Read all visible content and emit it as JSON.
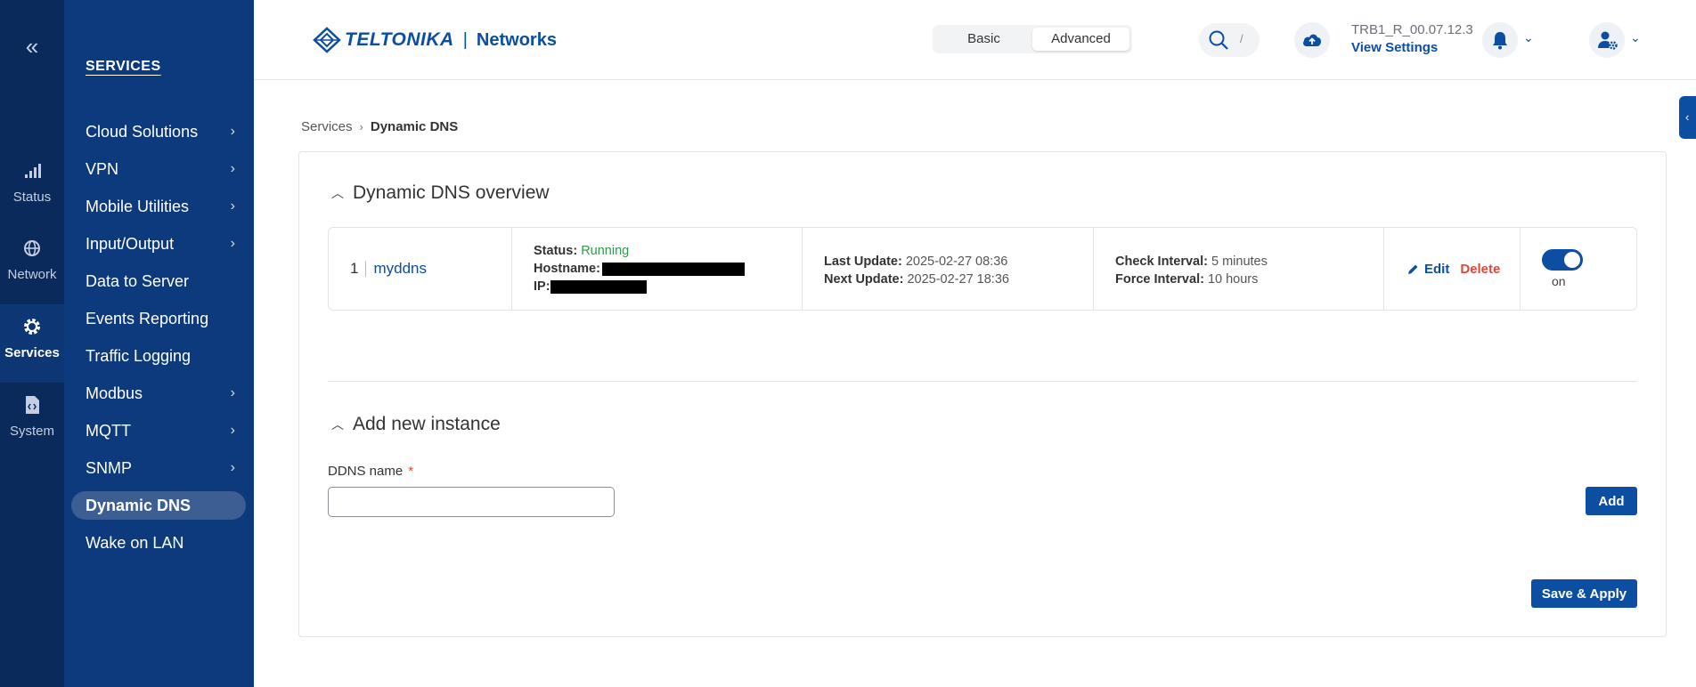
{
  "rail": {
    "collapse_icon": "double-chevron-left-icon",
    "items": [
      {
        "label": "Status",
        "icon": "signal-bars-icon",
        "active": false
      },
      {
        "label": "Network",
        "icon": "globe-icon",
        "active": false
      },
      {
        "label": "Services",
        "icon": "gear-icon",
        "active": true
      },
      {
        "label": "System",
        "icon": "file-code-icon",
        "active": false
      }
    ]
  },
  "menu": {
    "title": "SERVICES",
    "items": [
      {
        "label": "Cloud Solutions",
        "has_submenu": true
      },
      {
        "label": "VPN",
        "has_submenu": true
      },
      {
        "label": "Mobile Utilities",
        "has_submenu": true
      },
      {
        "label": "Input/Output",
        "has_submenu": true
      },
      {
        "label": "Data to Server",
        "has_submenu": false
      },
      {
        "label": "Events Reporting",
        "has_submenu": false
      },
      {
        "label": "Traffic Logging",
        "has_submenu": false
      },
      {
        "label": "Modbus",
        "has_submenu": true
      },
      {
        "label": "MQTT",
        "has_submenu": true
      },
      {
        "label": "SNMP",
        "has_submenu": true
      },
      {
        "label": "Dynamic DNS",
        "has_submenu": false,
        "active": true
      },
      {
        "label": "Wake on LAN",
        "has_submenu": false
      }
    ]
  },
  "header": {
    "logo_text": "TELTONIKA",
    "logo_separator": "|",
    "logo_product": "Networks",
    "mode": {
      "basic": "Basic",
      "advanced": "Advanced",
      "active": "Advanced"
    },
    "search_shortcut": "/",
    "firmware": "TRB1_R_00.07.12.3",
    "view_settings": "View Settings"
  },
  "breadcrumb": {
    "parent": "Services",
    "current": "Dynamic DNS"
  },
  "overview": {
    "title": "Dynamic DNS overview",
    "instances": [
      {
        "index": "1",
        "name": "myddns",
        "status_label": "Status:",
        "status_value": "Running",
        "hostname_label": "Hostname:",
        "ip_label": "IP:",
        "last_update_label": "Last Update:",
        "last_update_value": "2025-02-27 08:36",
        "next_update_label": "Next Update:",
        "next_update_value": "2025-02-27 18:36",
        "check_interval_label": "Check Interval:",
        "check_interval_value": "5 minutes",
        "force_interval_label": "Force Interval:",
        "force_interval_value": "10 hours",
        "edit_label": "Edit",
        "delete_label": "Delete",
        "enabled": true,
        "toggle_label": "on"
      }
    ]
  },
  "add_instance": {
    "title": "Add new instance",
    "field_label": "DDNS name",
    "required_mark": "*",
    "field_value": "",
    "add_button": "Add"
  },
  "save_button": "Save & Apply",
  "colors": {
    "brand": "#0c4ea2",
    "rail_bg": "#0a2a5c",
    "menu_bg": "#0c3a7c",
    "running": "#2e9a4a",
    "danger": "#e0483a"
  }
}
